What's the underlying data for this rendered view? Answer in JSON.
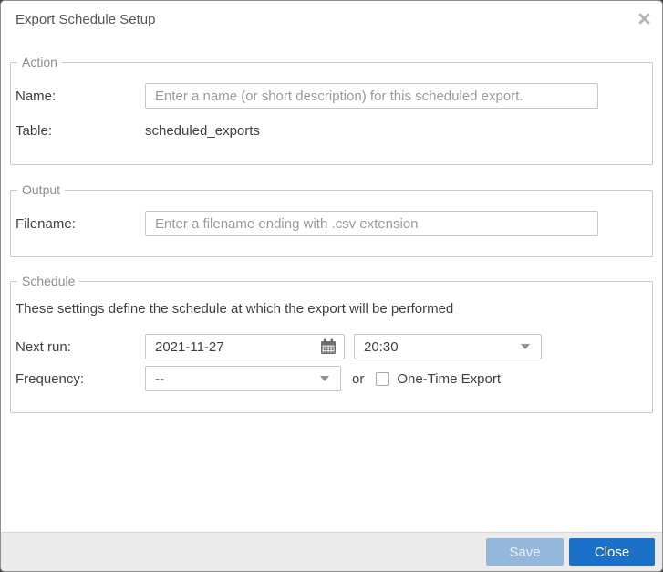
{
  "dialog": {
    "title": "Export Schedule Setup"
  },
  "action_section": {
    "legend": "Action",
    "name_label": "Name:",
    "name_placeholder": "Enter a name (or short description) for this scheduled export.",
    "table_label": "Table:",
    "table_value": "scheduled_exports"
  },
  "output_section": {
    "legend": "Output",
    "filename_label": "Filename:",
    "filename_placeholder": "Enter a filename ending with .csv extension"
  },
  "schedule_section": {
    "legend": "Schedule",
    "description": "These settings define the schedule at which the export will be performed",
    "next_run_label": "Next run:",
    "next_run_date": "2021-11-27",
    "next_run_time": "20:30",
    "frequency_label": "Frequency:",
    "frequency_value": "--",
    "or_label": "or",
    "one_time_label": "One-Time Export",
    "one_time_checked": false
  },
  "footer": {
    "save_label": "Save",
    "close_label": "Close"
  },
  "icons": {
    "close": "x-icon",
    "calendar": "calendar-icon",
    "dropdown": "chevron-down-icon"
  },
  "colors": {
    "close_button_bg": "#1b71c8",
    "save_button_bg": "#93b8dc",
    "footer_bg": "#ebebeb",
    "fieldset_border": "#c9c9c9",
    "legend_text": "#8b9094",
    "label_text": "#3d4144",
    "placeholder_text": "#9a9a9a"
  }
}
